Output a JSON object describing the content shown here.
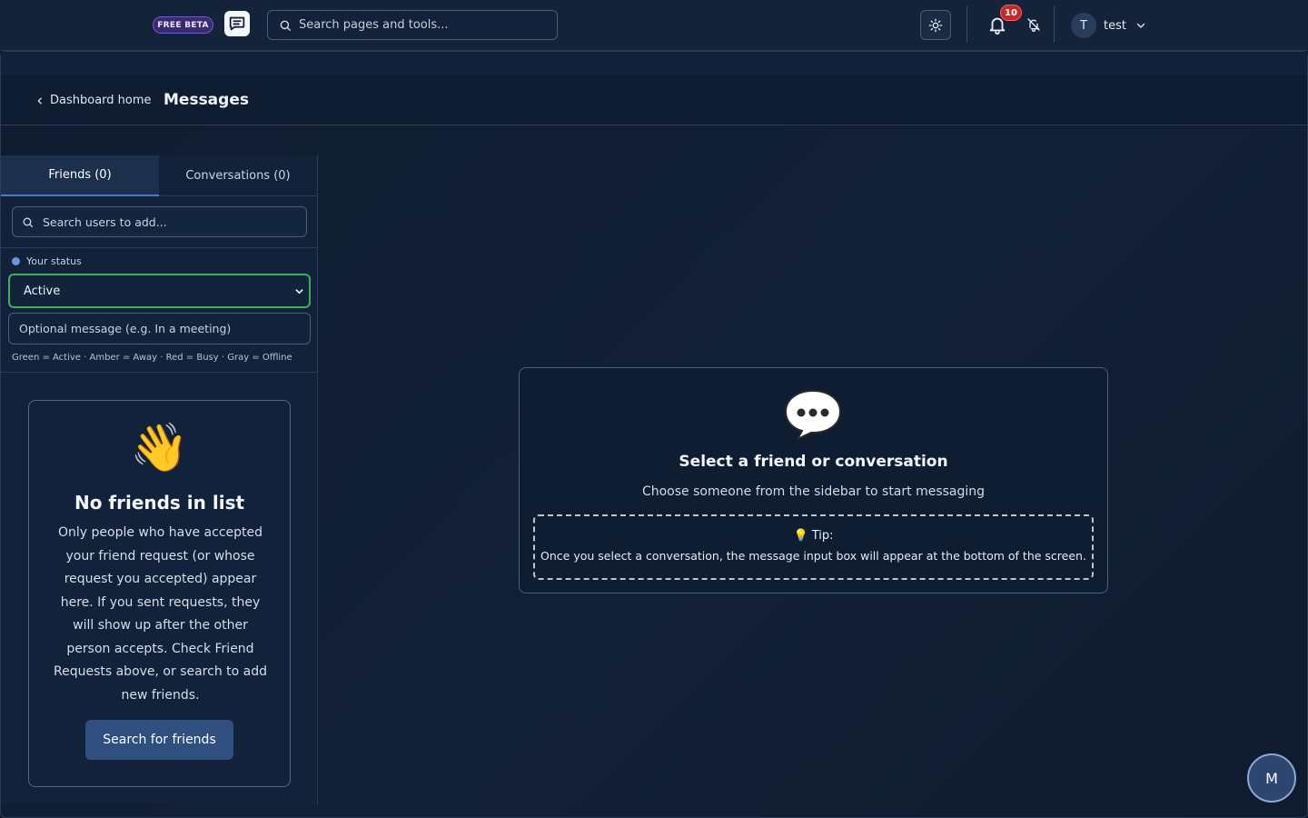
{
  "topbar": {
    "beta_badge": "FREE BETA",
    "search_placeholder": "Search pages and tools...",
    "notification_count": "10",
    "user_initial": "T",
    "user_name": "test"
  },
  "page": {
    "back_link": "Dashboard home",
    "title": "Messages"
  },
  "sidebar": {
    "tabs": [
      {
        "label": "Friends (0)",
        "active": true
      },
      {
        "label": "Conversations (0)",
        "active": false
      }
    ],
    "search_placeholder": "Search users to add...",
    "status_label": "Your status",
    "status_value": "Active",
    "status_message_placeholder": "Optional message (e.g. In a meeting)",
    "status_legend": "Green = Active · Amber = Away · Red = Busy · Gray = Offline",
    "empty_state": {
      "emoji": "👋",
      "title": "No friends in list",
      "body": "Only people who have accepted your friend request (or whose request you accepted) appear here. If you sent requests, they will show up after the other person accepts. Check Friend Requests above, or search to add new friends.",
      "button": "Search for friends"
    }
  },
  "main": {
    "title": "Select a friend or conversation",
    "subtitle": "Choose someone from the sidebar to start messaging",
    "tip_head": "💡 Tip:",
    "tip_text": "Once you select a conversation, the message input box will appear at the bottom of the screen."
  },
  "fab": {
    "label": "M"
  },
  "colors": {
    "background": "#0f1b2d",
    "accent": "#2f4f7e",
    "status_active": "#35b35a",
    "badge": "#c62828"
  }
}
